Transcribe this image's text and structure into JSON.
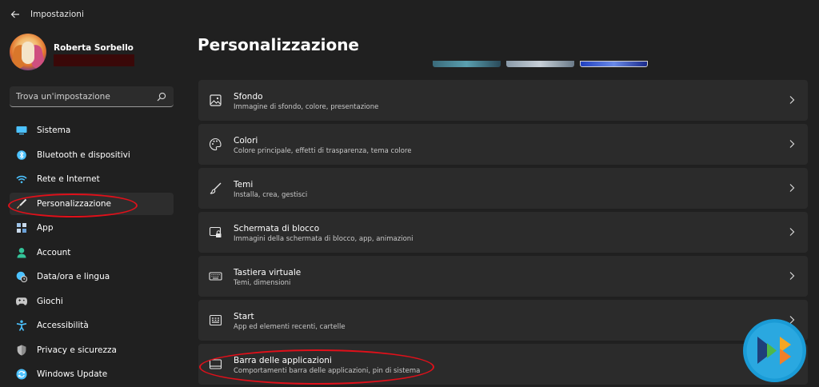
{
  "window": {
    "title": "Impostazioni"
  },
  "profile": {
    "name": "Roberta Sorbello"
  },
  "search": {
    "placeholder": "Trova un'impostazione"
  },
  "sidebar": {
    "items": [
      {
        "label": "Sistema",
        "icon": "monitor-icon",
        "color": "#4cc2ff"
      },
      {
        "label": "Bluetooth e dispositivi",
        "icon": "bluetooth-icon",
        "color": "#4cc2ff"
      },
      {
        "label": "Rete e Internet",
        "icon": "wifi-icon",
        "color": "#4cc2ff"
      },
      {
        "label": "Personalizzazione",
        "icon": "brush-icon",
        "color": "#f2b57a",
        "selected": true
      },
      {
        "label": "App",
        "icon": "apps-icon",
        "color": "#9ec3e8"
      },
      {
        "label": "Account",
        "icon": "person-icon",
        "color": "#34c49a"
      },
      {
        "label": "Data/ora e lingua",
        "icon": "globe-clock-icon",
        "color": "#4cc2ff"
      },
      {
        "label": "Giochi",
        "icon": "gamepad-icon",
        "color": "#c8c8c8"
      },
      {
        "label": "Accessibilità",
        "icon": "accessibility-icon",
        "color": "#4cc2ff"
      },
      {
        "label": "Privacy e sicurezza",
        "icon": "shield-icon",
        "color": "#b8b8b8"
      },
      {
        "label": "Windows Update",
        "icon": "update-icon",
        "color": "#4cc2ff"
      }
    ]
  },
  "main": {
    "title": "Personalizzazione",
    "cards": [
      {
        "title": "Sfondo",
        "subtitle": "Immagine di sfondo, colore, presentazione",
        "icon": "picture-icon"
      },
      {
        "title": "Colori",
        "subtitle": "Colore principale, effetti di trasparenza, tema colore",
        "icon": "palette-icon"
      },
      {
        "title": "Temi",
        "subtitle": "Installa, crea, gestisci",
        "icon": "brush-icon"
      },
      {
        "title": "Schermata di blocco",
        "subtitle": "Immagini della schermata di blocco, app, animazioni",
        "icon": "lock-screen-icon"
      },
      {
        "title": "Tastiera virtuale",
        "subtitle": "Temi, dimensioni",
        "icon": "keyboard-icon"
      },
      {
        "title": "Start",
        "subtitle": "App ed elementi recenti, cartelle",
        "icon": "start-icon"
      },
      {
        "title": "Barra delle applicazioni",
        "subtitle": "Comportamenti barra delle applicazioni, pin di sistema",
        "icon": "taskbar-icon"
      }
    ]
  },
  "colors": {
    "background": "#202020",
    "card": "#2b2b2b",
    "accent": "#4cc2ff",
    "annotation": "#e0101a"
  }
}
